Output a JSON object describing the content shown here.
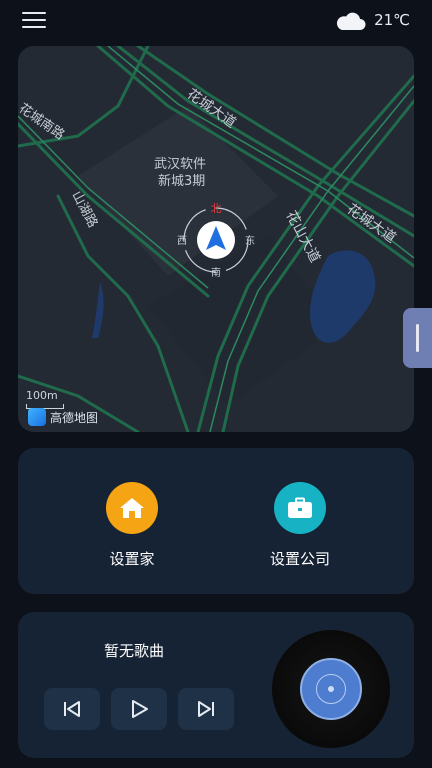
{
  "header": {
    "menu_icon": "hamburger-menu-icon",
    "weather_icon": "cloud-icon",
    "temperature": "21℃"
  },
  "map": {
    "roads": [
      "花城大道",
      "花城大道",
      "花山大道",
      "花城南路",
      "山湖路"
    ],
    "poi": [
      "武汉软件",
      "新城3期"
    ],
    "compass": {
      "north": "北",
      "south": "南",
      "east": "东",
      "west": "西"
    },
    "scale": "100m",
    "logo_text": "高德地图"
  },
  "quick_actions": [
    {
      "label": "设置家",
      "icon": "home-icon",
      "color": "#f5a514"
    },
    {
      "label": "设置公司",
      "icon": "briefcase-icon",
      "color": "#17b3c4"
    }
  ],
  "music": {
    "song_title": "暂无歌曲",
    "controls": [
      "previous-icon",
      "play-icon",
      "next-icon"
    ]
  }
}
